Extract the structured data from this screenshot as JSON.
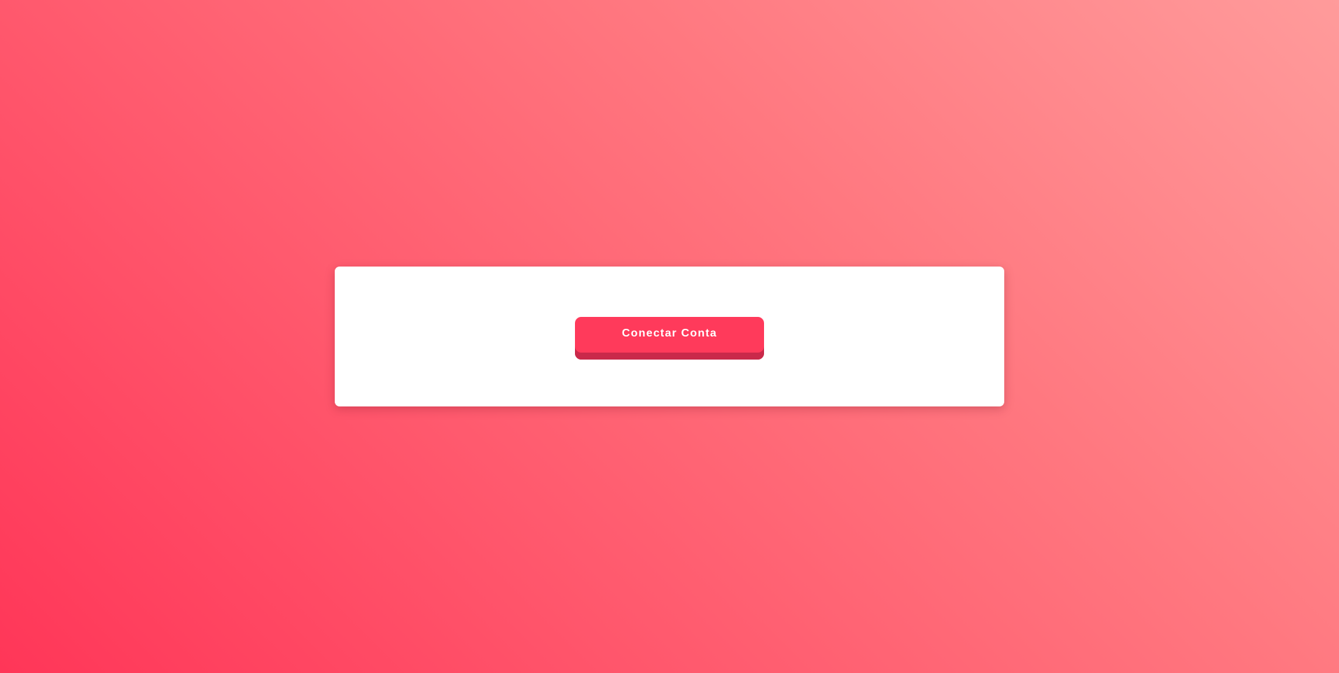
{
  "card": {
    "connect_button_label": "Conectar Conta"
  },
  "colors": {
    "background_start": "#ff3658",
    "background_end": "#ff9b9b",
    "button": "#ff3a5b",
    "button_shade": "#c9294a",
    "card": "#ffffff"
  }
}
